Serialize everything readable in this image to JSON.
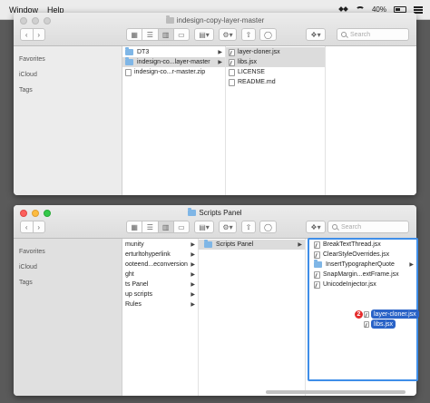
{
  "menubar": {
    "items": [
      "Window",
      "Help"
    ],
    "battery": "40%"
  },
  "window1": {
    "title": "indesign-copy-layer-master",
    "search_placeholder": "Search",
    "sidebar": [
      "Favorites",
      "iCloud",
      "Tags"
    ],
    "col1": [
      {
        "label": "DT3",
        "type": "folder",
        "selected": false,
        "arrow": true
      },
      {
        "label": "indesign-co...layer-master",
        "type": "folder",
        "selected": true,
        "arrow": true
      },
      {
        "label": "indesign-co...r-master.zip",
        "type": "file",
        "selected": false,
        "arrow": false
      }
    ],
    "col2": [
      {
        "label": "layer-cloner.jsx",
        "type": "jsx",
        "selected": true
      },
      {
        "label": "libs.jsx",
        "type": "jsx",
        "selected": true
      },
      {
        "label": "LICENSE",
        "type": "file",
        "selected": false
      },
      {
        "label": "README.md",
        "type": "file",
        "selected": false
      }
    ]
  },
  "window2": {
    "title": "Scripts Panel",
    "search_placeholder": "Search",
    "sidebar": [
      "Favorites",
      "iCloud",
      "Tags"
    ],
    "col1": [
      {
        "label": "munity"
      },
      {
        "label": "erturltohyperlink"
      },
      {
        "label": "ooteend...econversion"
      },
      {
        "label": "ght"
      },
      {
        "label": "ts Panel"
      },
      {
        "label": "up scripts"
      },
      {
        "label": "Rules"
      }
    ],
    "col2": [
      {
        "label": "Scripts Panel",
        "type": "folder",
        "selected": true
      }
    ],
    "col3": [
      {
        "label": "BreakTextThread.jsx",
        "type": "jsx"
      },
      {
        "label": "ClearStyleOverrides.jsx",
        "type": "jsx"
      },
      {
        "label": "InsertTypographerQuote",
        "type": "folder"
      },
      {
        "label": "SnapMargin...extFrame.jsx",
        "type": "jsx"
      },
      {
        "label": "UnicodeInjector.jsx",
        "type": "jsx"
      }
    ]
  },
  "drag": {
    "count": "2",
    "items": [
      "layer-cloner.jsx",
      "libs.jsx"
    ]
  },
  "colors": {
    "accent": "#2a63c7",
    "drop_outline": "#3f8ee8",
    "badge": "#e52b2b",
    "folder": "#7fb6e6"
  }
}
